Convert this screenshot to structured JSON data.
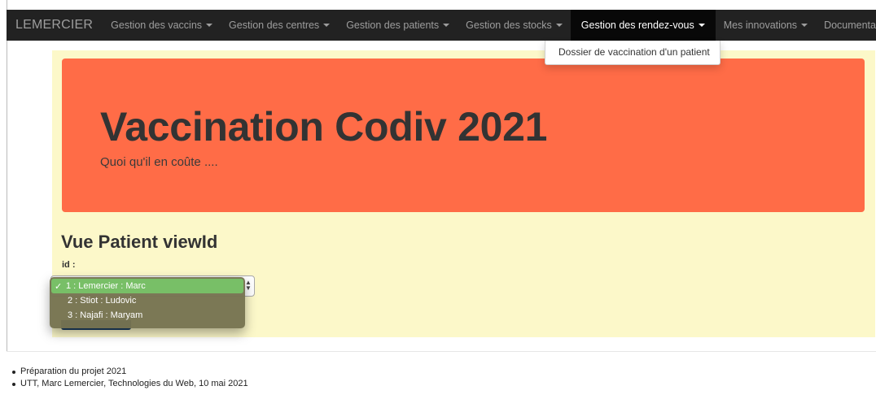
{
  "navbar": {
    "brand": "LEMERCIER",
    "items": [
      {
        "label": "Gestion des vaccins"
      },
      {
        "label": "Gestion des centres"
      },
      {
        "label": "Gestion des patients"
      },
      {
        "label": "Gestion des stocks"
      },
      {
        "label": "Gestion des rendez-vous"
      },
      {
        "label": "Mes innovations"
      },
      {
        "label": "Documentation"
      }
    ],
    "dropdown": {
      "items": [
        {
          "label": "Dossier de vaccination d'un patient"
        }
      ]
    }
  },
  "jumbotron": {
    "title": "Vaccination Codiv 2021",
    "subtitle": "Quoi qu'il en coûte ...."
  },
  "form": {
    "title": "Vue Patient viewId",
    "id_label": "id :",
    "selected_mark": "✓",
    "options": [
      {
        "label": "1 : Lemercier : Marc"
      },
      {
        "label": "2 : Stiot : Ludovic"
      },
      {
        "label": "3 : Najafi : Maryam"
      }
    ]
  },
  "footer": {
    "items": [
      {
        "label": "Préparation du projet 2021"
      },
      {
        "label": "UTT, Marc Lemercier, Technologies du Web, 10 mai 2021"
      }
    ]
  },
  "colors": {
    "navbar_bg": "#222222",
    "jumbotron_bg": "#ff6c47",
    "container_bg": "#fcf8c9",
    "selected_option_bg": "#78bf67"
  }
}
